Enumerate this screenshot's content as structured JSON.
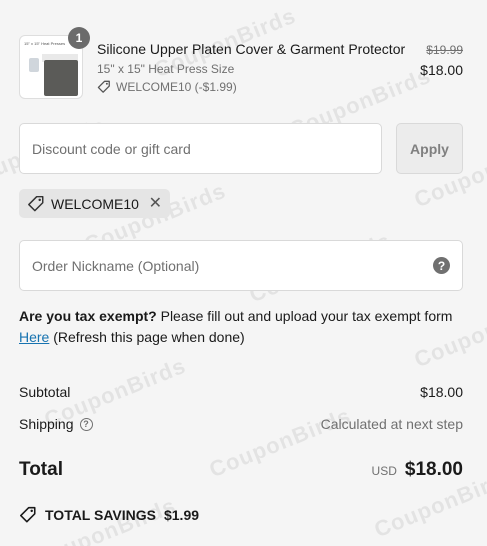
{
  "product": {
    "quantity": "1",
    "title": "Silicone Upper Platen Cover & Garment Protector",
    "variant": "15\" x 15\" Heat Press Size",
    "discount_line": "WELCOME10 (-$1.99)",
    "original_price": "$19.99",
    "price": "$18.00",
    "thumb_caption": "15\" x 15\" Heat Presses"
  },
  "discount": {
    "placeholder": "Discount code or gift card",
    "apply_label": "Apply",
    "applied_code": "WELCOME10"
  },
  "nickname": {
    "placeholder": "Order Nickname (Optional)",
    "help_glyph": "?"
  },
  "tax": {
    "bold": "Are you tax exempt?",
    "text": " Please fill out and upload your tax exempt form ",
    "link": "Here",
    "after_link": " (Refresh this page when done)"
  },
  "summary": {
    "subtotal_label": "Subtotal",
    "subtotal_value": "$18.00",
    "shipping_label": "Shipping",
    "shipping_value": "Calculated at next step",
    "total_label": "Total",
    "currency": "USD",
    "total_value": "$18.00",
    "savings_label": "TOTAL SAVINGS",
    "savings_value": "$1.99"
  },
  "watermark": "CouponBirds",
  "colors": {
    "link": "#1773b0",
    "background": "#f5f5f5",
    "muted_text": "#707070"
  },
  "icons": [
    "tag-icon",
    "close-icon",
    "help-icon",
    "question-circle-icon",
    "savings-tag-icon"
  ]
}
